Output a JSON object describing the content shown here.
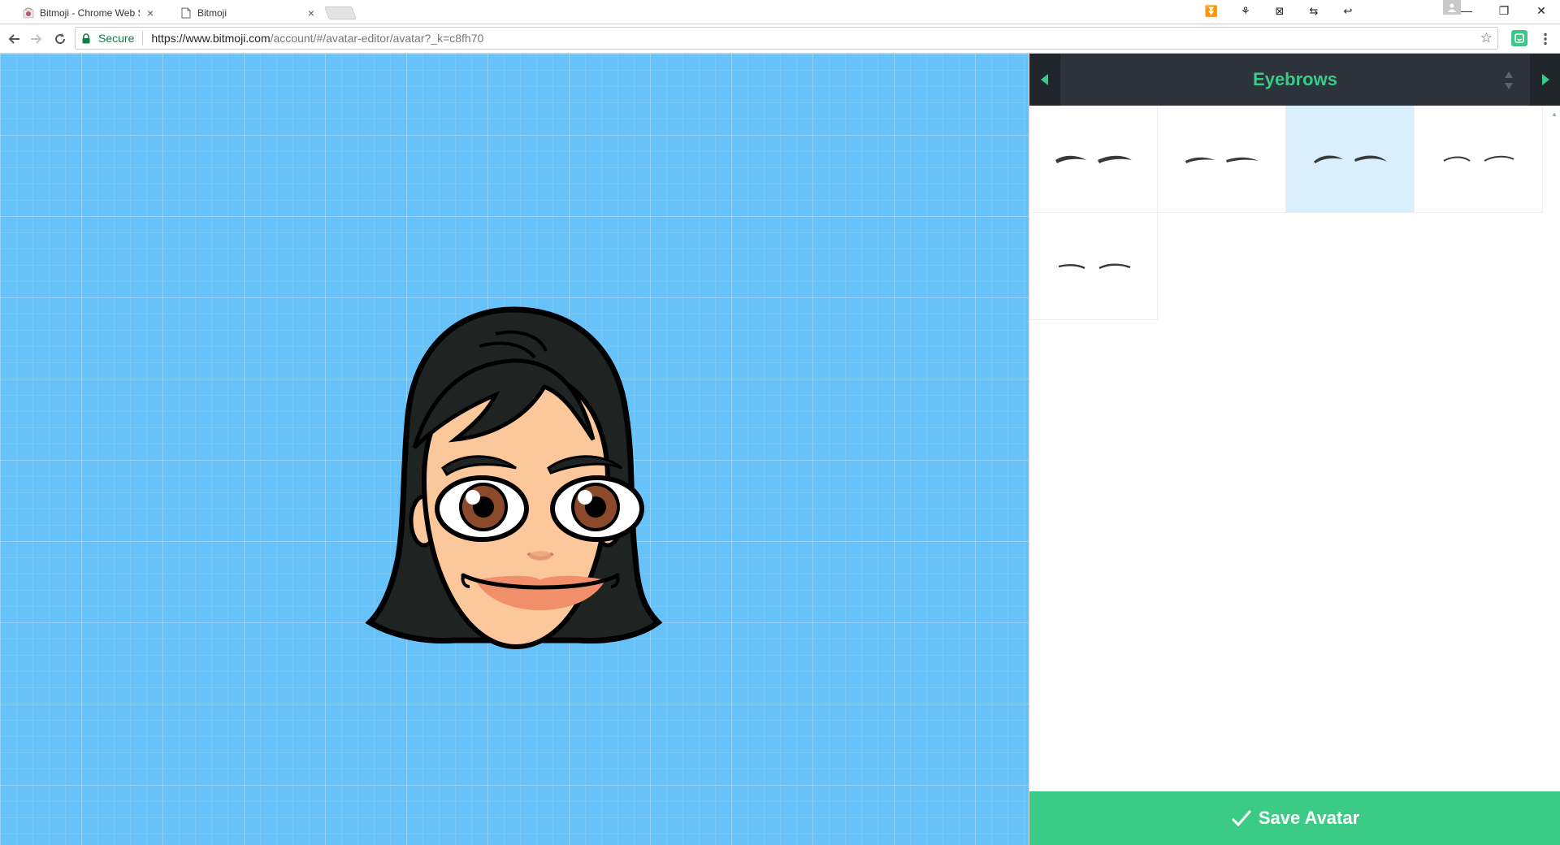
{
  "browser": {
    "tabs": [
      {
        "title": "Bitmoji - Chrome Web St",
        "active": false
      },
      {
        "title": "Bitmoji",
        "active": true
      }
    ],
    "tab_close_glyph": "×",
    "secure_label": "Secure",
    "url_host": "https://www.bitmoji.com",
    "url_path": "/account/#/avatar-editor/avatar?_k=c8fh70",
    "icons": {
      "back": "arrow-left-icon",
      "forward": "arrow-right-icon",
      "reload": "reload-icon",
      "bookmark": "star-icon",
      "menu": "kebab-menu-icon",
      "lock": "lock-icon"
    },
    "extension_glyphs": [
      "⏬",
      "⚘",
      "⊠",
      "⇆",
      "↩"
    ],
    "window_controls": {
      "minimize": "—",
      "restore": "❐",
      "close": "✕"
    }
  },
  "editor": {
    "section_title": "Eyebrows",
    "selected_index": 2,
    "options": [
      {
        "style": "bold-arch"
      },
      {
        "style": "medium-flat"
      },
      {
        "style": "medium-arch"
      },
      {
        "style": "thin-arch"
      },
      {
        "style": "thin-flat"
      }
    ],
    "save_label": "Save Avatar"
  },
  "colors": {
    "canvas_bg": "#66c2f8",
    "accent_green": "#3ccb87",
    "header_dark": "#2d333b",
    "selected_cell": "#d9effb",
    "hair": "#1f2322",
    "skin": "#fcc89b"
  }
}
